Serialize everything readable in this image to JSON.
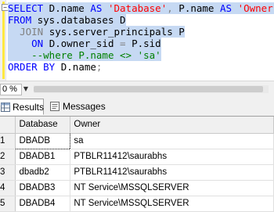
{
  "editor": {
    "collapse_symbol": "−",
    "lines": [
      [
        {
          "t": "SELECT",
          "c": "kw"
        },
        {
          "t": " D.name "
        },
        {
          "t": "AS",
          "c": "kw"
        },
        {
          "t": " "
        },
        {
          "t": "'Database'",
          "c": "str"
        },
        {
          "t": ",",
          "c": "op"
        },
        {
          "t": " P.name "
        },
        {
          "t": "AS",
          "c": "kw"
        },
        {
          "t": " "
        },
        {
          "t": "'Owner'",
          "c": "str"
        }
      ],
      [
        {
          "t": "FROM",
          "c": "kw"
        },
        {
          "t": " sys.databases D"
        }
      ],
      [
        {
          "t": "  "
        },
        {
          "t": "JOIN",
          "c": "op"
        },
        {
          "t": " sys.server_principals P"
        }
      ],
      [
        {
          "t": "    "
        },
        {
          "t": "ON",
          "c": "kw"
        },
        {
          "t": " D.owner_sid "
        },
        {
          "t": "=",
          "c": "op"
        },
        {
          "t": " P.sid"
        }
      ],
      [
        {
          "t": "    "
        },
        {
          "t": "--where P.name <> 'sa'",
          "c": "cmt"
        }
      ],
      [
        {
          "t": "ORDER BY",
          "c": "kw"
        },
        {
          "t": " D.name"
        },
        {
          "t": ";",
          "c": "op"
        }
      ]
    ]
  },
  "status": {
    "zoom_value": "0 %",
    "zoom_arrow": "▼"
  },
  "tabs": {
    "results_label": "Results",
    "messages_label": "Messages"
  },
  "grid": {
    "columns": [
      "Database",
      "Owner"
    ],
    "rows": [
      {
        "num": "1",
        "database": "DBADB",
        "owner": "sa"
      },
      {
        "num": "2",
        "database": "DBADB1",
        "owner": "PTBLR11412\\saurabhs"
      },
      {
        "num": "3",
        "database": "dbadb2",
        "owner": "PTBLR11412\\saurabhs"
      },
      {
        "num": "4",
        "database": "DBADB3",
        "owner": "NT Service\\MSSQLSERVER"
      },
      {
        "num": "5",
        "database": "DBADB4",
        "owner": "NT Service\\MSSQLSERVER"
      }
    ]
  }
}
